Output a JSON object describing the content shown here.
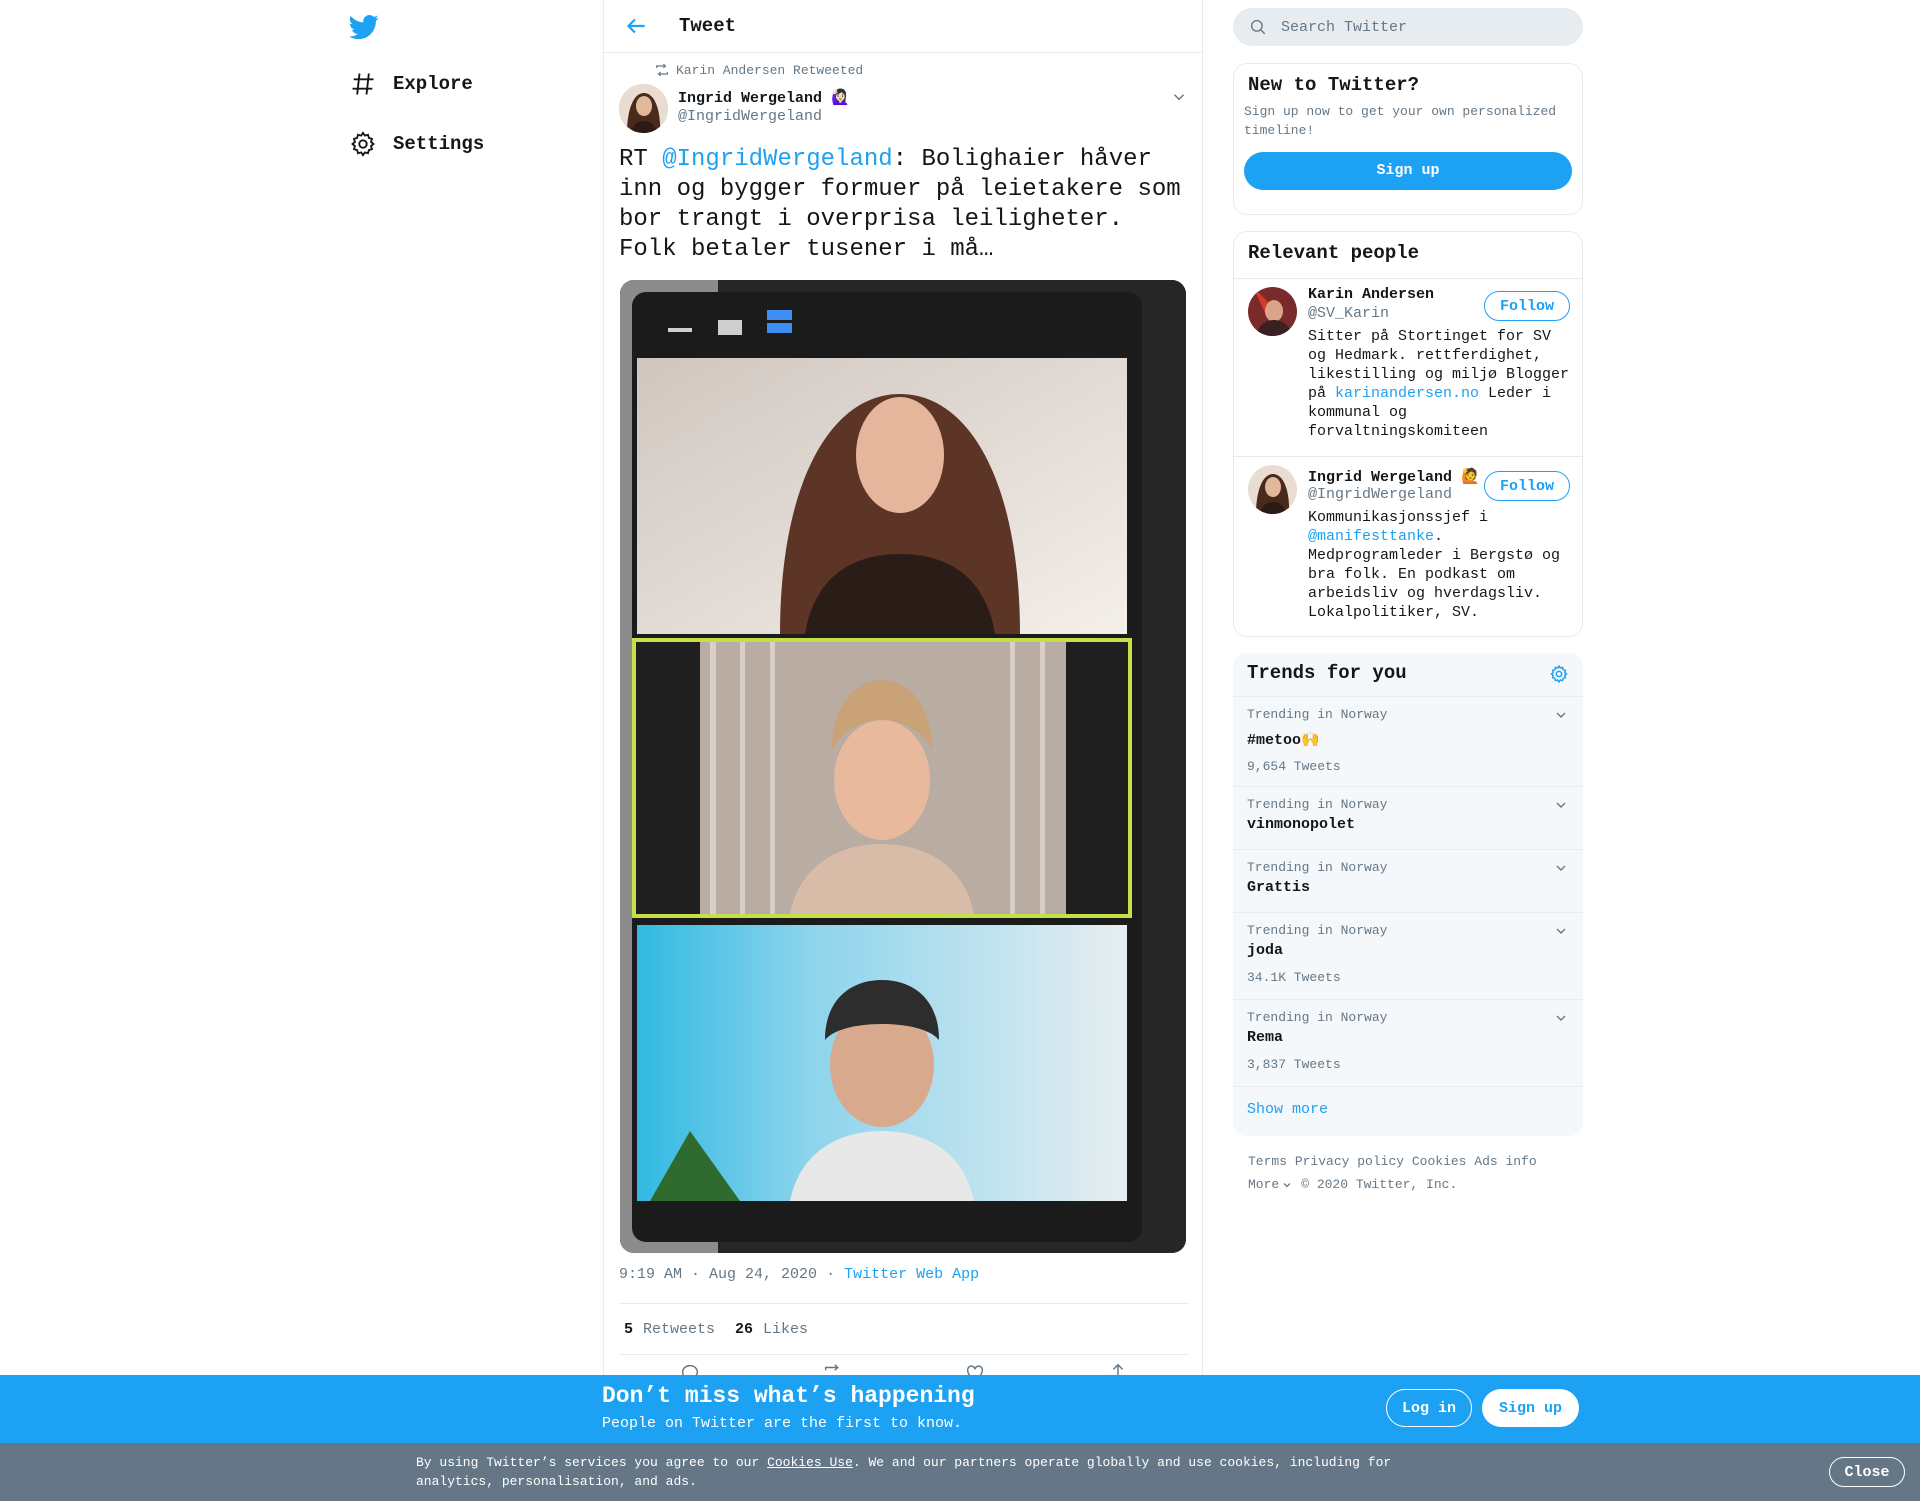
{
  "nav": {
    "explore": "Explore",
    "settings": "Settings"
  },
  "header": {
    "title": "Tweet"
  },
  "tweet": {
    "retweeted_by": "Karin Andersen Retweeted",
    "author_name": "Ingrid Wergeland",
    "author_emoji": "🙋🏻‍♀️",
    "author_handle": "@IngridWergeland",
    "text_prefix": "RT ",
    "text_mention": "@IngridWergeland",
    "text_body": ": Bolighaier håver inn og bygger formuer på leietakere som bor trangt i overprisa leiligheter. Folk betaler tusener i må…",
    "time": "9:19 AM · Aug 24, 2020",
    "dot": "·",
    "source": "Twitter Web App",
    "retweets_count": "5",
    "retweets_label": "Retweets",
    "likes_count": "26",
    "likes_label": "Likes"
  },
  "search": {
    "placeholder": "Search Twitter"
  },
  "new_to_twitter": {
    "title": "New to Twitter?",
    "text": "Sign up now to get your own personalized timeline!",
    "button": "Sign up"
  },
  "relevant": {
    "title": "Relevant people",
    "people": [
      {
        "name": "Karin Andersen",
        "handle": "@SV_Karin",
        "follow": "Follow",
        "bio_pre": "Sitter på Stortinget for SV og Hedmark. rettferdighet, likestilling og miljø Blogger på ",
        "bio_link": "karinandersen.no",
        "bio_post": " Leder i kommunal og forvaltningskomiteen"
      },
      {
        "name": "Ingrid Wergeland",
        "emoji": "🙋",
        "handle": "@IngridWergeland",
        "follow": "Follow",
        "bio_pre": "Kommunikasjonssjef i ",
        "bio_link": "@manifesttanke",
        "bio_post": ". Medprogramleder i Bergstø og bra folk. En podkast om arbeidsliv og hverdagsliv. Lokalpolitiker, SV."
      }
    ]
  },
  "trends": {
    "title": "Trends for you",
    "items": [
      {
        "context": "Trending in Norway",
        "name": "#metoo",
        "emoji": "🙌",
        "count": "9,654 Tweets"
      },
      {
        "context": "Trending in Norway",
        "name": "vinmonopolet",
        "count": ""
      },
      {
        "context": "Trending in Norway",
        "name": "Grattis",
        "count": ""
      },
      {
        "context": "Trending in Norway",
        "name": "joda",
        "count": "34.1K Tweets"
      },
      {
        "context": "Trending in Norway",
        "name": "Rema",
        "count": "3,837 Tweets"
      }
    ],
    "show_more": "Show more"
  },
  "footer": {
    "terms": "Terms",
    "privacy": "Privacy policy",
    "cookies": "Cookies",
    "ads": "Ads info",
    "more": "More",
    "copyright": "© 2020 Twitter, Inc."
  },
  "banner": {
    "headline": "Don’t miss what’s happening",
    "sub": "People on Twitter are the first to know.",
    "login": "Log in",
    "signup": "Sign up"
  },
  "cookie": {
    "pre": "By using Twitter’s services you agree to our ",
    "link": "Cookies Use",
    "post": ". We and our partners operate globally and use cookies, including for analytics, personalisation, and ads.",
    "close": "Close"
  },
  "colors": {
    "accent": "#1da1f2",
    "text": "#14171a",
    "muted": "#657786",
    "border": "#e6ecf0",
    "cookie_bar": "#657786"
  }
}
